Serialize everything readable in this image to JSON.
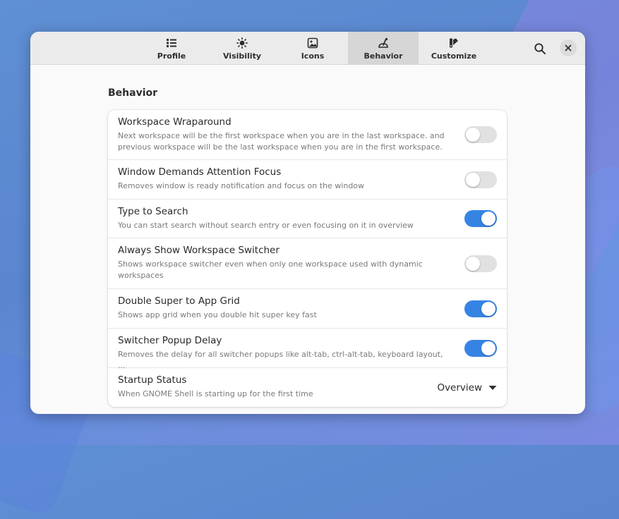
{
  "header": {
    "tabs": [
      {
        "label": "Profile",
        "icon": "list-icon",
        "active": false
      },
      {
        "label": "Visibility",
        "icon": "sun-icon",
        "active": false
      },
      {
        "label": "Icons",
        "icon": "image-icon",
        "active": false
      },
      {
        "label": "Behavior",
        "icon": "behavior-icon",
        "active": true
      },
      {
        "label": "Customize",
        "icon": "customize-icon",
        "active": false
      }
    ],
    "search_icon": "search-icon",
    "close_icon": "close-icon"
  },
  "section": {
    "title": "Behavior",
    "rows": [
      {
        "title": "Workspace Wraparound",
        "subtitle": "Next workspace will be the first workspace when you are in the last workspace. and previous workspace will be the last workspace when you are in the first workspace.",
        "control": "switch",
        "on": false
      },
      {
        "title": "Window Demands Attention Focus",
        "subtitle": "Removes window is ready notification and focus on the window",
        "control": "switch",
        "on": false
      },
      {
        "title": "Type to Search",
        "subtitle": "You can start search without search entry or even focusing on it in overview",
        "control": "switch",
        "on": true
      },
      {
        "title": "Always Show Workspace Switcher",
        "subtitle": "Shows workspace switcher even when only one workspace used with dynamic workspaces",
        "control": "switch",
        "on": false
      },
      {
        "title": "Double Super to App Grid",
        "subtitle": "Shows app grid when you double hit super key fast",
        "control": "switch",
        "on": true
      },
      {
        "title": "Switcher Popup Delay",
        "subtitle": "Removes the delay for all switcher popups like alt-tab, ctrl-alt-tab, keyboard layout, ...",
        "control": "switch",
        "on": true
      },
      {
        "title": "Startup Status",
        "subtitle": "When GNOME Shell is starting up for the first time",
        "control": "dropdown",
        "value": "Overview"
      }
    ]
  },
  "colors": {
    "accent": "#3584e4",
    "switch_off": "#e1e1e1"
  }
}
